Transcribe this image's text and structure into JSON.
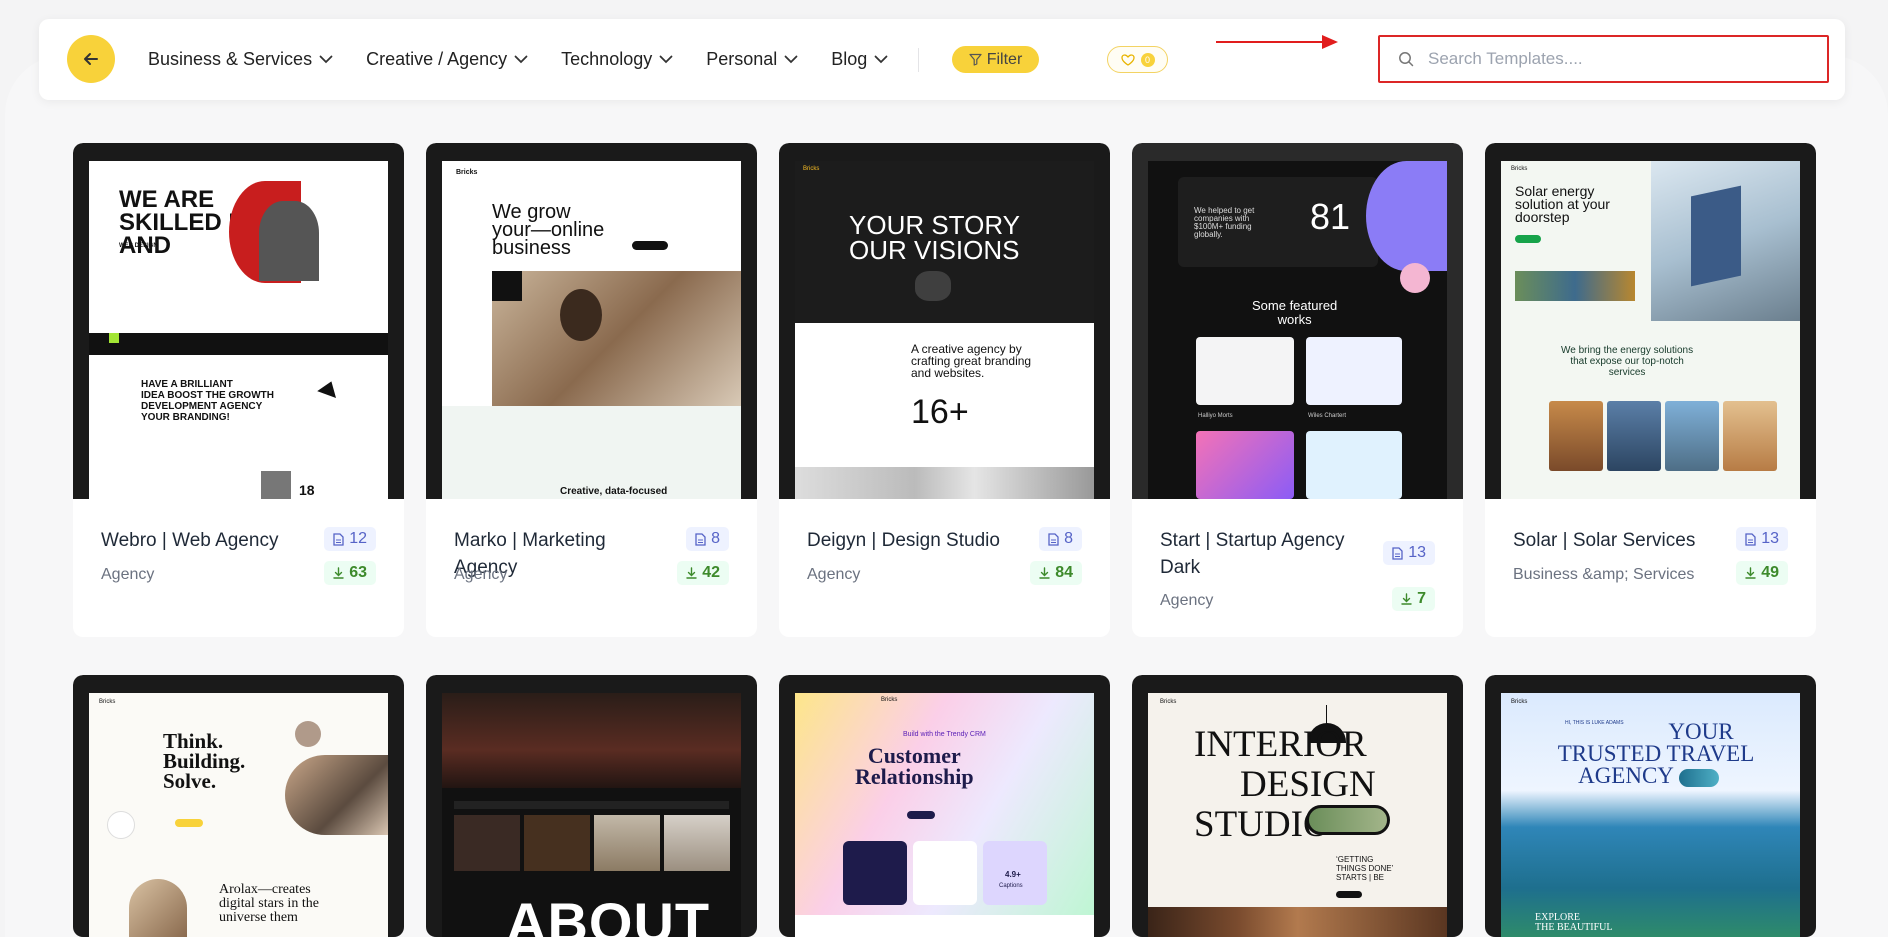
{
  "nav": {
    "items": [
      {
        "label": "Business & Services"
      },
      {
        "label": "Creative / Agency"
      },
      {
        "label": "Technology"
      },
      {
        "label": "Personal"
      },
      {
        "label": "Blog"
      }
    ],
    "filter_label": "Filter",
    "favorites_count": "0",
    "search_placeholder": "Search Templates...."
  },
  "templates": [
    {
      "title": "Webro | Web Agency",
      "category": "Agency",
      "pages": "12",
      "downloads": "63",
      "preview": {
        "headline": [
          "WE ARE",
          "SKILLED IN",
          "AND"
        ],
        "small": "WEB DESIGN",
        "sub": [
          "HAVE A BRILLIANT",
          "IDEA BOOST THE GROWTH",
          "DEVELOPMENT AGENCY",
          "YOUR BRANDING!"
        ],
        "num": "18"
      }
    },
    {
      "title": "Marko | Marketing Agency",
      "category": "Agency",
      "pages": "8",
      "downloads": "42",
      "preview": {
        "logo": "Bricks",
        "headline": [
          "We grow",
          "your—online",
          "business"
        ],
        "footer": "Creative, data-focused"
      }
    },
    {
      "title": "Deigyn | Design Studio",
      "category": "Agency",
      "pages": "8",
      "downloads": "84",
      "preview": {
        "logo": "Bricks",
        "headline": [
          "YOUR STORY",
          "OUR VISIONS"
        ],
        "sub": [
          "A creative agency by",
          "crafting great branding",
          "and websites."
        ],
        "num": "16+"
      }
    },
    {
      "title": "Start | Startup Agency Dark",
      "category": "Agency",
      "pages": "13",
      "downloads": "7",
      "preview": {
        "tag": [
          "We helped to get",
          "companies with",
          "$100M+ funding",
          "globally."
        ],
        "num": "81",
        "sub": [
          "Some featured",
          "works"
        ],
        "cap1": "Halliyo Morts",
        "cap2": "Wiles Chartert"
      }
    },
    {
      "title": "Solar | Solar Services",
      "category": "Business &amp; Services",
      "pages": "13",
      "downloads": "49",
      "preview": {
        "logo": "Bricks",
        "headline": [
          "Solar energy",
          "solution at your",
          "doorstep"
        ],
        "sub": [
          "We bring the energy solutions",
          "that expose our top-notch",
          "services"
        ]
      }
    },
    {
      "title": "",
      "category": "",
      "pages": "",
      "downloads": "",
      "preview": {
        "logo": "Bricks",
        "headline": [
          "Think.",
          "Building.",
          "Solve."
        ],
        "sub": [
          "Arolax—creates",
          "digital stars in the",
          "universe them"
        ]
      }
    },
    {
      "title": "",
      "category": "",
      "pages": "",
      "downloads": "",
      "preview": {
        "headline": [
          "ABOUT"
        ]
      }
    },
    {
      "title": "",
      "category": "",
      "pages": "",
      "downloads": "",
      "preview": {
        "logo": "Bricks",
        "tag": "Build with the Trendy CRM",
        "headline": [
          "Customer",
          "Relationship"
        ],
        "num": "4.9+",
        "cap1": "Captions"
      }
    },
    {
      "title": "",
      "category": "",
      "pages": "",
      "downloads": "",
      "preview": {
        "logo": "Bricks",
        "headline": [
          "INTERIOR",
          "DESIGN",
          "STUDIO"
        ],
        "sub": [
          "‘GETTING",
          "THINGS DONE’",
          "STARTS | BE"
        ]
      }
    },
    {
      "title": "",
      "category": "",
      "pages": "",
      "downloads": "",
      "preview": {
        "logo": "Bricks",
        "tag": "HI, THIS IS LUKE ADAMS",
        "headline": [
          "YOUR",
          "TRUSTED TRAVEL",
          "AGENCY"
        ],
        "sub": [
          "EXPLORE",
          "THE BEAUTIFUL"
        ]
      }
    }
  ]
}
